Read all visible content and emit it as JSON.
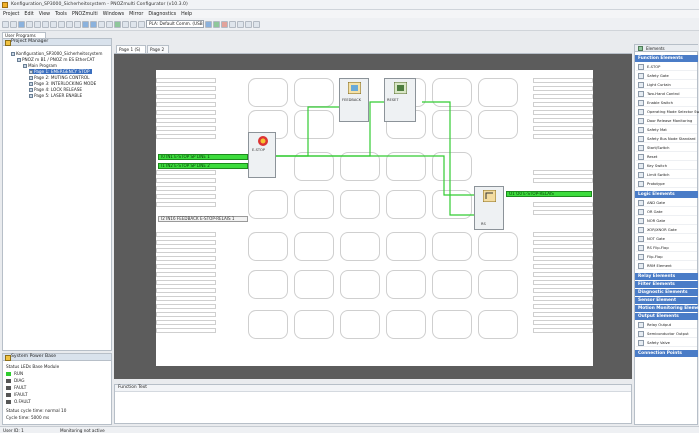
{
  "window": {
    "title": "Konfiguration_SP3000_Sicherheitssystem - PNOZmulti Configurator (v10.3.0)"
  },
  "menu": [
    "Project",
    "Edit",
    "View",
    "Tools",
    "PNOZmulti",
    "Windows",
    "Mirror",
    "Diagnostics",
    "Help"
  ],
  "toolbar": {
    "mode_value": "PLA: Default Comm. (USB)"
  },
  "project_manager": {
    "tab": "User Programs",
    "title": "Project Manager",
    "tree": [
      "Konfiguration_SP3000_Sicherheitssystem",
      "PNOZ m B1 / PNOZ m ES EtherCAT",
      "Main Program",
      "Page 1: EMERGENCY STOP",
      "Page 2: MUTING CONTROL",
      "Page 3: INTERLOCKING MODE",
      "Page 4: LOCK RELEASE",
      "Page 5: LASER ENABLE"
    ]
  },
  "status_panel": {
    "title": "System Power Base",
    "heading": "Status LEDs Base Module",
    "leds": [
      {
        "label": "RUN",
        "color": "#2ecc2e"
      },
      {
        "label": "DIAG",
        "color": "#555555"
      },
      {
        "label": "FAULT",
        "color": "#555555"
      },
      {
        "label": "IFAULT",
        "color": "#555555"
      },
      {
        "label": "O.FAULT",
        "color": "#555555"
      }
    ],
    "cycle_time": "Status cycle time: normal  10",
    "cycle_max": "Cycle time: 5000 ms"
  },
  "editor": {
    "tabs": [
      "Page 1 (S)",
      "Page 2"
    ],
    "pins_in": [
      "I0 IN1 E-STOP SP LINE 1",
      "I1 IN2 E-STOP SP LINE 2",
      "I2 IN16 FEEDBACK E-STOP-RELAIS 1"
    ],
    "pins_out": [
      "O1 O0 E-STOP-RELAIS"
    ],
    "blocks": [
      {
        "label": "E-STOP"
      },
      {
        "label": "FEEDBACK"
      },
      {
        "label": "RESET"
      },
      {
        "label": "RS"
      }
    ]
  },
  "function_text": {
    "title": "Function Text"
  },
  "right_panel": {
    "tabs": [
      "Elements"
    ],
    "sections": [
      {
        "title": "Function Elements",
        "items": [
          "E-STOP",
          "Safety Gate",
          "Light Curtain",
          "Two-Hand Control",
          "Enable Switch",
          "Operating Mode Selector Switch",
          "Door Release Monitoring",
          "Safety Mat",
          "Safety Bus Node Standard",
          "Start/Switch",
          "Reset",
          "Key Switch",
          "Limit Switch",
          "Prototype"
        ]
      },
      {
        "title": "Logic Elements",
        "items": [
          "AND Gate",
          "OR Gate",
          "NOR Gate",
          "XOR/XNOR Gate",
          "NOT Gate",
          "RS Flip-Flop",
          "Flip-Flop",
          "RRM Element"
        ]
      },
      {
        "title": "Relay Elements",
        "items": []
      },
      {
        "title": "Filter Elements",
        "items": []
      },
      {
        "title": "Diagnostic Elements",
        "items": []
      },
      {
        "title": "Sensor Element",
        "items": []
      },
      {
        "title": "Motion Monitoring Elements",
        "items": []
      },
      {
        "title": "Output Elements",
        "items": [
          "Relay Output",
          "Semiconductor Output",
          "Safety Valve"
        ]
      },
      {
        "title": "Connection Points",
        "items": []
      }
    ]
  },
  "statusbar": {
    "left": "User ID: 1",
    "msg": "Monitoring not active"
  }
}
